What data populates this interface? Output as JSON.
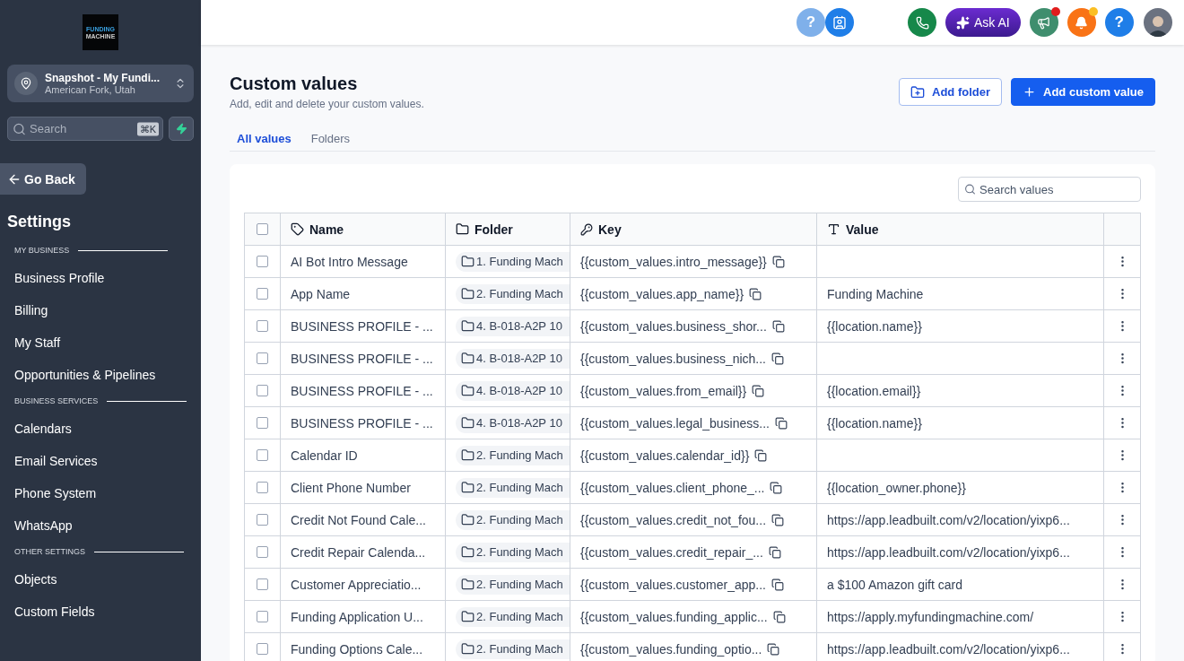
{
  "sidebar": {
    "logo_lines": [
      "FUNDING",
      "MACHINE"
    ],
    "account": {
      "name": "Snapshot - My Fundi...",
      "location": "American Fork, Utah"
    },
    "search": {
      "placeholder": "Search",
      "shortcut": "⌘K"
    },
    "back": "Go Back",
    "title": "Settings",
    "sections": [
      {
        "heading": "MY BUSINESS",
        "items": [
          "Business Profile",
          "Billing",
          "My Staff",
          "Opportunities & Pipelines"
        ]
      },
      {
        "heading": "BUSINESS SERVICES",
        "items": [
          "Calendars",
          "Email Services",
          "Phone System",
          "WhatsApp"
        ]
      },
      {
        "heading": "OTHER SETTINGS",
        "items": [
          "Objects",
          "Custom Fields"
        ]
      }
    ]
  },
  "header": {
    "ask_ai": "Ask AI",
    "help": "?",
    "help_left": "?"
  },
  "page": {
    "title": "Custom values",
    "subtitle": "Add, edit and delete your custom values.",
    "buttons": [
      {
        "kind": "outline",
        "label": "Add folder"
      },
      {
        "kind": "primary",
        "label": "Add custom value"
      }
    ],
    "tabs": [
      {
        "label": "All values",
        "selected": true
      },
      {
        "label": "Folders",
        "selected": false
      }
    ],
    "search": {
      "placeholder": "Search values"
    }
  },
  "table": {
    "select_all_checked": false,
    "columns": [
      {
        "kind": "name",
        "label": "Name"
      },
      {
        "kind": "folder",
        "label": "Folder"
      },
      {
        "kind": "key",
        "label": "Key"
      },
      {
        "kind": "value",
        "label": "Value"
      }
    ],
    "rows": [
      {
        "checked": false,
        "name": "AI Bot Intro Message",
        "folder": "1. Funding Mach",
        "key": "{{custom_values.intro_message}}",
        "value": ""
      },
      {
        "checked": false,
        "name": "App Name",
        "folder": "2. Funding Mach",
        "key": "{{custom_values.app_name}}",
        "value": "Funding Machine"
      },
      {
        "checked": false,
        "name": "BUSINESS PROFILE - ...",
        "folder": "4. B-018-A2P 10",
        "key": "{{custom_values.business_shor...",
        "value": "{{location.name}}"
      },
      {
        "checked": false,
        "name": "BUSINESS PROFILE - ...",
        "folder": "4. B-018-A2P 10",
        "key": "{{custom_values.business_nich...",
        "value": ""
      },
      {
        "checked": false,
        "name": "BUSINESS PROFILE - ...",
        "folder": "4. B-018-A2P 10",
        "key": "{{custom_values.from_email}}",
        "value": "{{location.email}}"
      },
      {
        "checked": false,
        "name": "BUSINESS PROFILE - ...",
        "folder": "4. B-018-A2P 10",
        "key": "{{custom_values.legal_business...",
        "value": "{{location.name}}"
      },
      {
        "checked": false,
        "name": "Calendar ID",
        "folder": "2. Funding Mach",
        "key": "{{custom_values.calendar_id}}",
        "value": ""
      },
      {
        "checked": false,
        "name": "Client Phone Number",
        "folder": "2. Funding Mach",
        "key": "{{custom_values.client_phone_...",
        "value": "{{location_owner.phone}}"
      },
      {
        "checked": false,
        "name": "Credit Not Found Cale...",
        "folder": "2. Funding Mach",
        "key": "{{custom_values.credit_not_fou...",
        "value": "https://app.leadbuilt.com/v2/location/yixp6..."
      },
      {
        "checked": false,
        "name": "Credit Repair Calenda...",
        "folder": "2. Funding Mach",
        "key": "{{custom_values.credit_repair_...",
        "value": "https://app.leadbuilt.com/v2/location/yixp6..."
      },
      {
        "checked": false,
        "name": "Customer Appreciatio...",
        "folder": "2. Funding Mach",
        "key": "{{custom_values.customer_app...",
        "value": "a $100 Amazon gift card"
      },
      {
        "checked": false,
        "name": "Funding Application U...",
        "folder": "2. Funding Mach",
        "key": "{{custom_values.funding_applic...",
        "value": "https://apply.myfundingmachine.com/"
      },
      {
        "checked": false,
        "name": "Funding Options Cale...",
        "folder": "2. Funding Mach",
        "key": "{{custom_values.funding_optio...",
        "value": "https://app.leadbuilt.com/v2/location/yixp6..."
      }
    ]
  }
}
